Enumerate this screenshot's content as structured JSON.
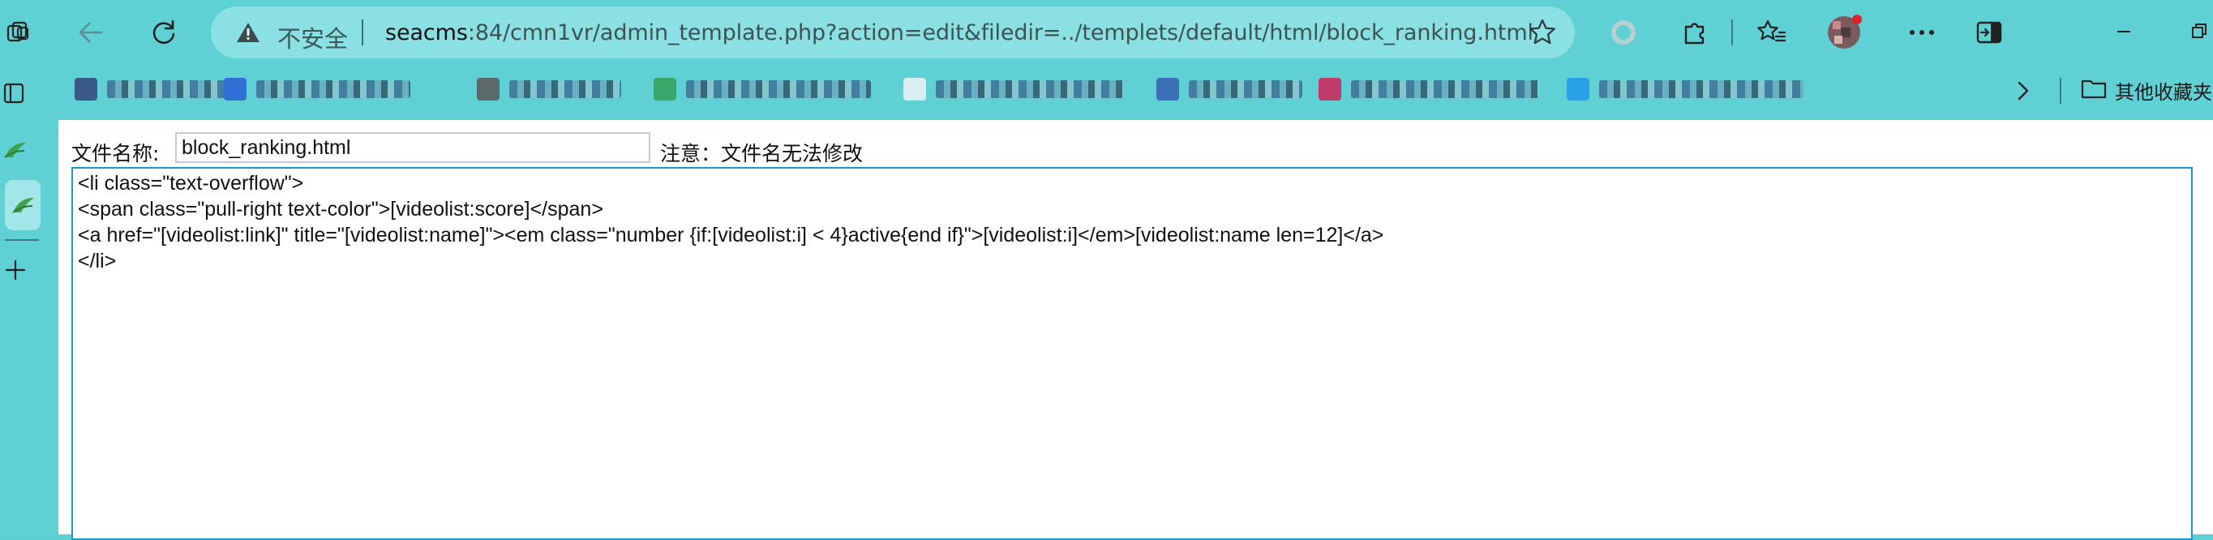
{
  "browser": {
    "address_bar": {
      "security_label": "不安全",
      "url_host": "seacms",
      "url_rest": ":84/cmn1vr/admin_template.php?action=edit&filedir=../templets/default/html/block_ranking.html"
    },
    "bookmarks_other_label": "其他收藏夹",
    "bookmarks": [
      {
        "favicon_color": "#3a5a8a"
      },
      {
        "favicon_color": "#2f6fd6"
      },
      {
        "favicon_color": "#5a6a6a"
      },
      {
        "favicon_color": "#3aa86a"
      },
      {
        "favicon_color": "#d8eef0"
      },
      {
        "favicon_color": "#3d6fb6"
      },
      {
        "favicon_color": "#c03a6a"
      },
      {
        "favicon_color": "#2aa0e8"
      }
    ]
  },
  "form": {
    "filename_label": "文件名称:",
    "filename_value": "block_ranking.html",
    "filename_note": "注意：文件名无法修改"
  },
  "editor": {
    "lines": [
      "<li class=\"text-overflow\">",
      "<span class=\"pull-right text-color\">[videolist:score]</span>",
      "<a href=\"[videolist:link]\" title=\"[videolist:name]\"><em class=\"number {if:[videolist:i] < 4}active{end if}\">[videolist:i]</em>[videolist:name len=12]</a>",
      "</li>"
    ]
  },
  "colors": {
    "chrome_bg": "#5fd1d4",
    "address_bg": "#8ae0e2",
    "editor_border": "#1a9bd0"
  }
}
